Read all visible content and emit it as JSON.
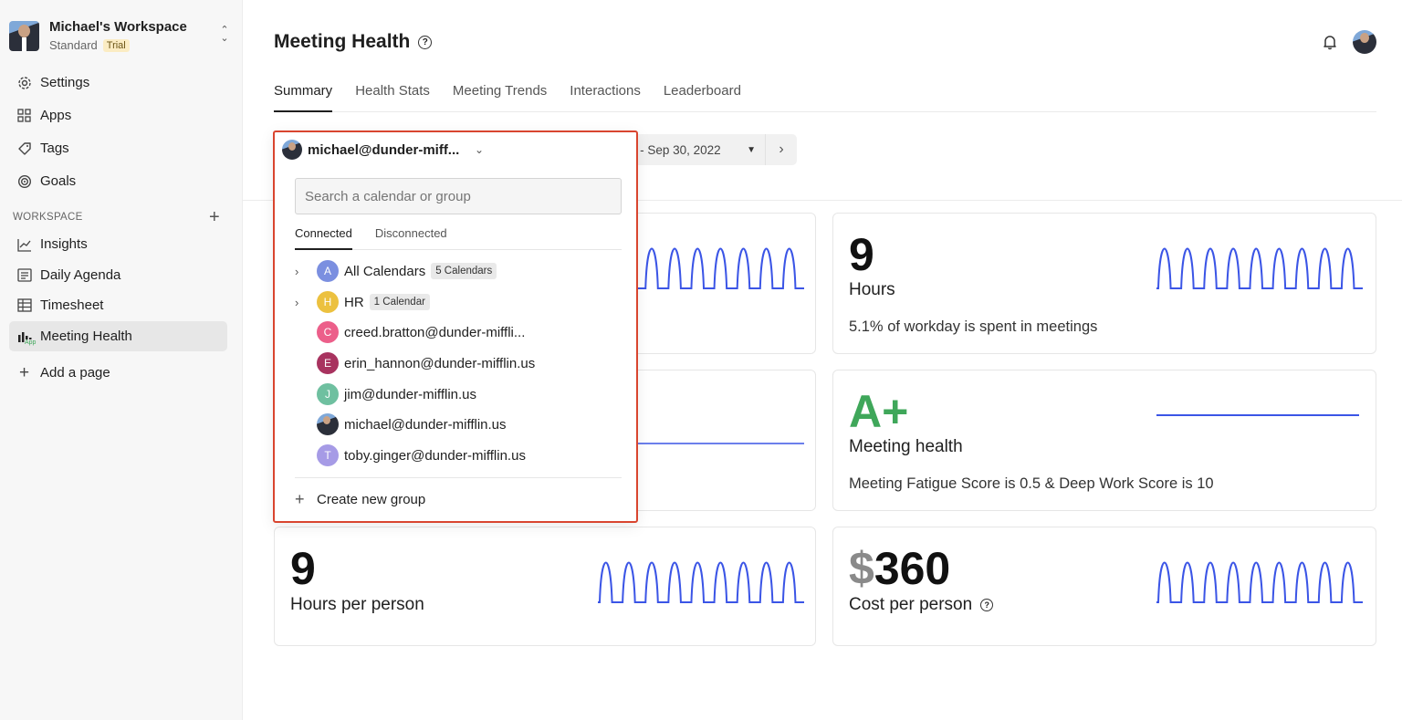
{
  "workspace": {
    "name": "Michael's Workspace",
    "plan": "Standard",
    "badge": "Trial"
  },
  "sidebar": {
    "top_items": [
      {
        "label": "Settings",
        "icon": "gear-icon"
      },
      {
        "label": "Apps",
        "icon": "grid-icon"
      },
      {
        "label": "Tags",
        "icon": "tag-icon"
      },
      {
        "label": "Goals",
        "icon": "target-icon"
      }
    ],
    "section_label": "WORKSPACE",
    "workspace_items": [
      {
        "label": "Insights",
        "icon": "chart-line-icon"
      },
      {
        "label": "Daily Agenda",
        "icon": "agenda-icon"
      },
      {
        "label": "Timesheet",
        "icon": "table-icon"
      },
      {
        "label": "Meeting Health",
        "icon": "bars-icon",
        "active": true,
        "sub_badge": "App"
      }
    ],
    "add_page": "Add a page"
  },
  "header": {
    "title": "Meeting Health"
  },
  "tabs": [
    "Summary",
    "Health Stats",
    "Meeting Trends",
    "Interactions",
    "Leaderboard"
  ],
  "toolbar": {
    "calendar_selected": "michael@dunder-miff...",
    "date_range": "Sep 01, 2022 - Sep 30, 2022"
  },
  "dropdown": {
    "search_placeholder": "Search a calendar or group",
    "tabs": [
      "Connected",
      "Disconnected"
    ],
    "items": [
      {
        "letter": "A",
        "label": "All Calendars",
        "pill": "5 Calendars",
        "color": "#7b8fe0",
        "expandable": true
      },
      {
        "letter": "H",
        "label": "HR",
        "pill": "1 Calendar",
        "color": "#ecc13f",
        "expandable": true
      },
      {
        "letter": "C",
        "label": "creed.bratton@dunder-miffli...",
        "color": "#ec5f8a"
      },
      {
        "letter": "E",
        "label": "erin_hannon@dunder-mifflin.us",
        "color": "#a8335f"
      },
      {
        "letter": "J",
        "label": "jim@dunder-mifflin.us",
        "color": "#6fc0a0"
      },
      {
        "letter": "",
        "label": "michael@dunder-mifflin.us",
        "photo": true
      },
      {
        "letter": "T",
        "label": "toby.ginger@dunder-mifflin.us",
        "color": "#a69be6"
      }
    ],
    "create_group": "Create new group"
  },
  "cards": {
    "hours": {
      "value": "9",
      "label": "Hours",
      "desc": "5.1% of workday is spent in meetings"
    },
    "health": {
      "value": "A+",
      "label": "Meeting health",
      "desc": "Meeting Fatigue Score is 0.5 & Deep Work Score is 10"
    },
    "hours_per_person": {
      "value": "9",
      "label": "Hours per person"
    },
    "cost": {
      "currency": "$",
      "value": "360",
      "label": "Cost per person"
    }
  },
  "colors": {
    "accent_line": "#3b55e6",
    "dropdown_border": "#d9452f",
    "grade": "#3fa75a"
  }
}
